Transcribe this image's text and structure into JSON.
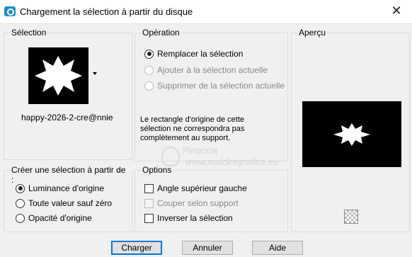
{
  "window": {
    "title": "Chargement la sélection à partir du disque",
    "close_label": "✕"
  },
  "selection_group": {
    "label": "Sélection",
    "file_name": "happy-2026-2-cre@nnie"
  },
  "operation_group": {
    "label": "Opération",
    "options": [
      {
        "label": "Remplacer la sélection",
        "checked": true,
        "enabled": true
      },
      {
        "label": "Ajouter à la sélection actuelle",
        "checked": false,
        "enabled": false
      },
      {
        "label": "Supprimer de la sélection actuelle",
        "checked": false,
        "enabled": false
      }
    ],
    "note_line1": "Le rectangle d'origine de cette",
    "note_line2": "sélection ne correspondra pas",
    "note_line3": "complètement au support."
  },
  "preview_group": {
    "label": "Aperçu",
    "checker_icon": "transparency-checker-icon"
  },
  "create_group": {
    "label": "Créer une sélection à partir de :",
    "options": [
      {
        "label": "Luminance d'origine",
        "checked": true
      },
      {
        "label": "Toute valeur sauf zéro",
        "checked": false
      },
      {
        "label": "Opacité d'origine",
        "checked": false
      }
    ]
  },
  "options_group": {
    "label": "Options",
    "items": [
      {
        "label": "Angle supérieur gauche",
        "checked": false,
        "enabled": true
      },
      {
        "label": "Couper selon support",
        "checked": false,
        "enabled": false
      },
      {
        "label": "Inverser la sélection",
        "checked": false,
        "enabled": true
      }
    ]
  },
  "buttons": {
    "ok": "Charger",
    "cancel": "Annuler",
    "help": "Aide"
  },
  "watermark": {
    "line1": "Pinuccia",
    "line2": "www.maidiregrafica.eu"
  },
  "colors": {
    "accent": "#0078d7",
    "selection_shape": "#ffffff",
    "shape_bg": "#000000"
  }
}
